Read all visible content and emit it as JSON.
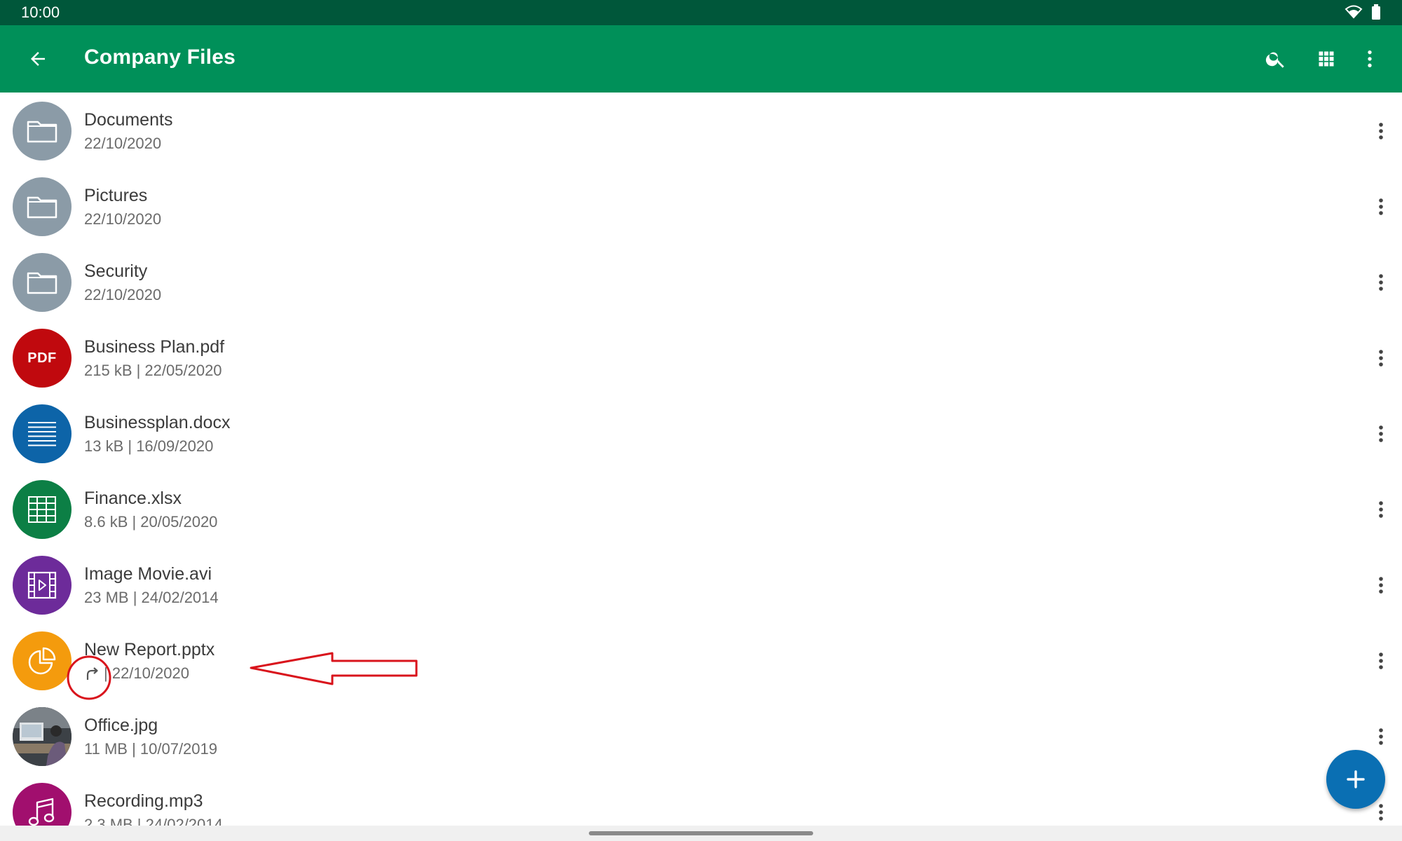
{
  "status_bar": {
    "time": "10:00"
  },
  "app_bar": {
    "title": "Company Files",
    "color": "#009059",
    "status_color": "#00573a",
    "actions": [
      "search-icon",
      "grid-view-icon",
      "more-vert-icon"
    ]
  },
  "files": [
    {
      "name": "Documents",
      "meta": "22/10/2020",
      "type": "folder",
      "icon": "folder-icon",
      "color": "#8b9ba7"
    },
    {
      "name": "Pictures",
      "meta": "22/10/2020",
      "type": "folder",
      "icon": "folder-icon",
      "color": "#8b9ba7"
    },
    {
      "name": "Security",
      "meta": "22/10/2020",
      "type": "folder",
      "icon": "folder-icon",
      "color": "#8b9ba7"
    },
    {
      "name": "Business Plan.pdf",
      "meta": "215 kB | 22/05/2020",
      "type": "pdf",
      "icon": "pdf-icon",
      "icon_text": "PDF",
      "color": "#c0090e"
    },
    {
      "name": "Businessplan.docx",
      "meta": "13 kB | 16/09/2020",
      "type": "docx",
      "icon": "document-icon",
      "color": "#0d64a8"
    },
    {
      "name": "Finance.xlsx",
      "meta": "8.6 kB | 20/05/2020",
      "type": "xlsx",
      "icon": "spreadsheet-icon",
      "color": "#0c7f45"
    },
    {
      "name": "Image Movie.avi",
      "meta": "23 MB | 24/02/2014",
      "type": "video",
      "icon": "video-icon",
      "color": "#6d2b9a"
    },
    {
      "name": "New Report.pptx",
      "meta": "| 22/10/2020",
      "type": "pptx",
      "icon": "presentation-icon",
      "color": "#f49b0d",
      "shared_icon": "share-arrow-icon"
    },
    {
      "name": "Office.jpg",
      "meta": "11 MB | 10/07/2019",
      "type": "image",
      "icon": "image-thumbnail",
      "color": "#4a4f55"
    },
    {
      "name": "Recording.mp3",
      "meta": "2.3 MB | 24/02/2014",
      "type": "audio",
      "icon": "music-note-icon",
      "color": "#a10f6e"
    }
  ],
  "fab": {
    "icon": "add-icon",
    "color": "#0a6fb3"
  },
  "annotation": {
    "color": "#d9141c",
    "target": "New Report.pptx"
  }
}
